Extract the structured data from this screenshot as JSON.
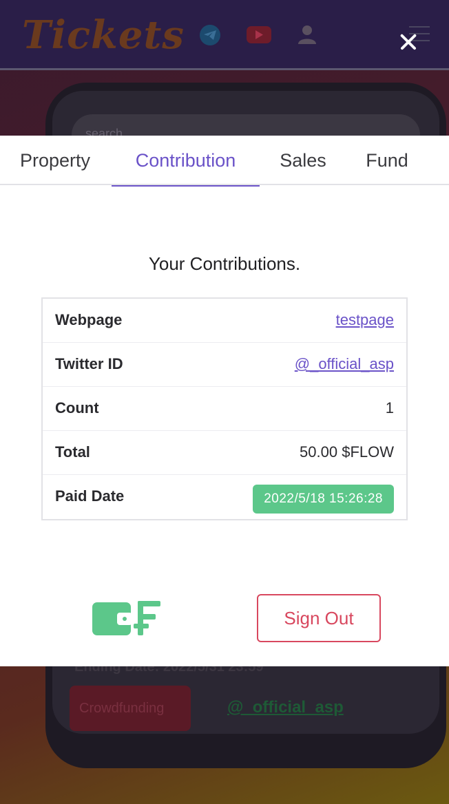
{
  "background": {
    "logo": "Tickets",
    "search_placeholder": "search",
    "ending_date": "Ending Date: 2022/5/31 23:59",
    "crowdfunding_label": "Crowdfunding",
    "creator_handle": "@_official_asp"
  },
  "tabs": [
    {
      "label": "Property"
    },
    {
      "label": "Contribution"
    },
    {
      "label": "Sales"
    },
    {
      "label": "Fund"
    }
  ],
  "active_tab": "Contribution",
  "contributions": {
    "heading": "Your Contributions.",
    "rows": [
      {
        "key": "Webpage",
        "value": "testpage"
      },
      {
        "key": "Twitter ID",
        "value": "@_official_asp"
      },
      {
        "key": "Count",
        "value": "1"
      },
      {
        "key": "Total",
        "value": "50.00 $FLOW"
      },
      {
        "key": "Paid Date",
        "value": "2022/5/18 15:26:28"
      }
    ]
  },
  "actions": {
    "sign_out": "Sign Out"
  },
  "colors": {
    "accent": "#6a52c8",
    "success": "#5cc78a",
    "danger": "#d8475e",
    "header_bg": "#2a1e48"
  }
}
